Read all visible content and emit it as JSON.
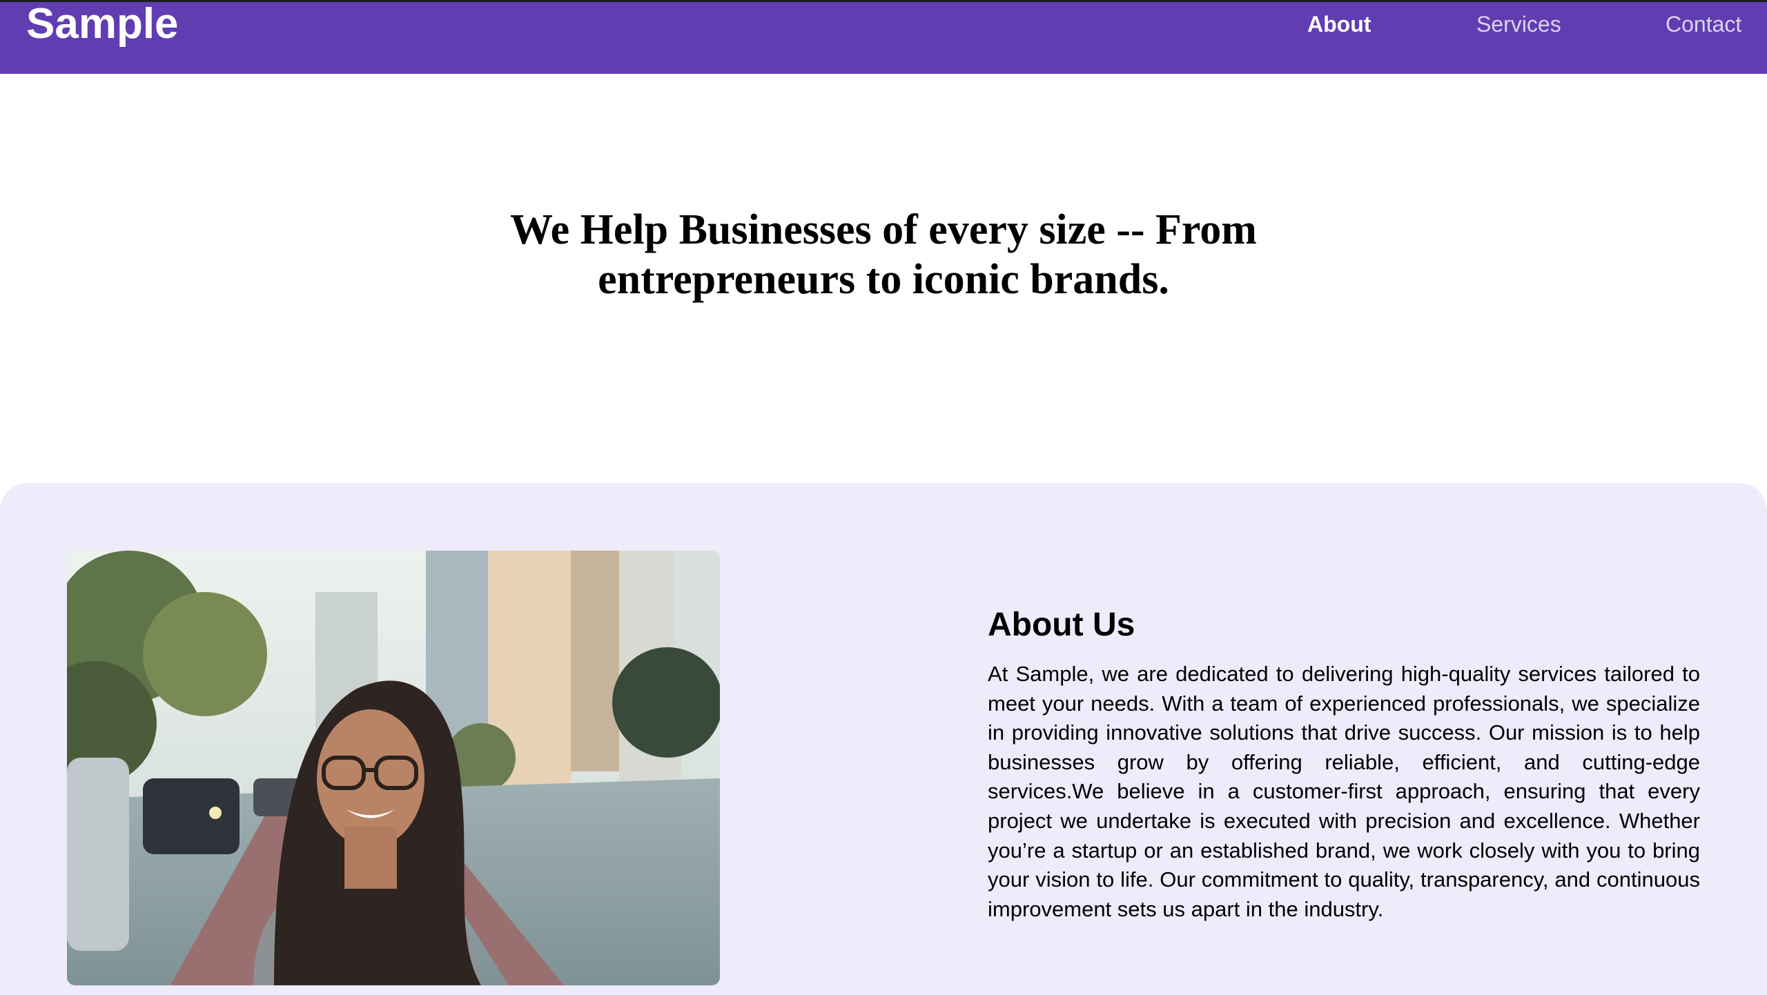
{
  "header": {
    "brand": "Sample",
    "nav": [
      {
        "label": "About",
        "active": true
      },
      {
        "label": "Services",
        "active": false
      },
      {
        "label": "Contact",
        "active": false
      }
    ]
  },
  "hero": {
    "title": "We Help Businesses of every size -- From entrepreneurs to iconic brands."
  },
  "about": {
    "heading": "About Us",
    "body": "At Sample, we are dedicated to delivering high-quality services tailored to meet your needs. With a team of experienced professionals, we specialize in providing innovative solutions that drive success. Our mission is to help businesses grow by offering reliable, efficient, and cutting-edge services.We believe in a customer-first approach, ensuring that every project we undertake is executed with precision and excellence. Whether you’re a startup or an established brand, we work closely with you to bring your vision to life. Our commitment to quality, transparency, and continuous improvement sets us apart in the industry."
  },
  "colors": {
    "nav_bg": "#613db2",
    "section_bg": "#eeebfb",
    "text": "#000000"
  }
}
